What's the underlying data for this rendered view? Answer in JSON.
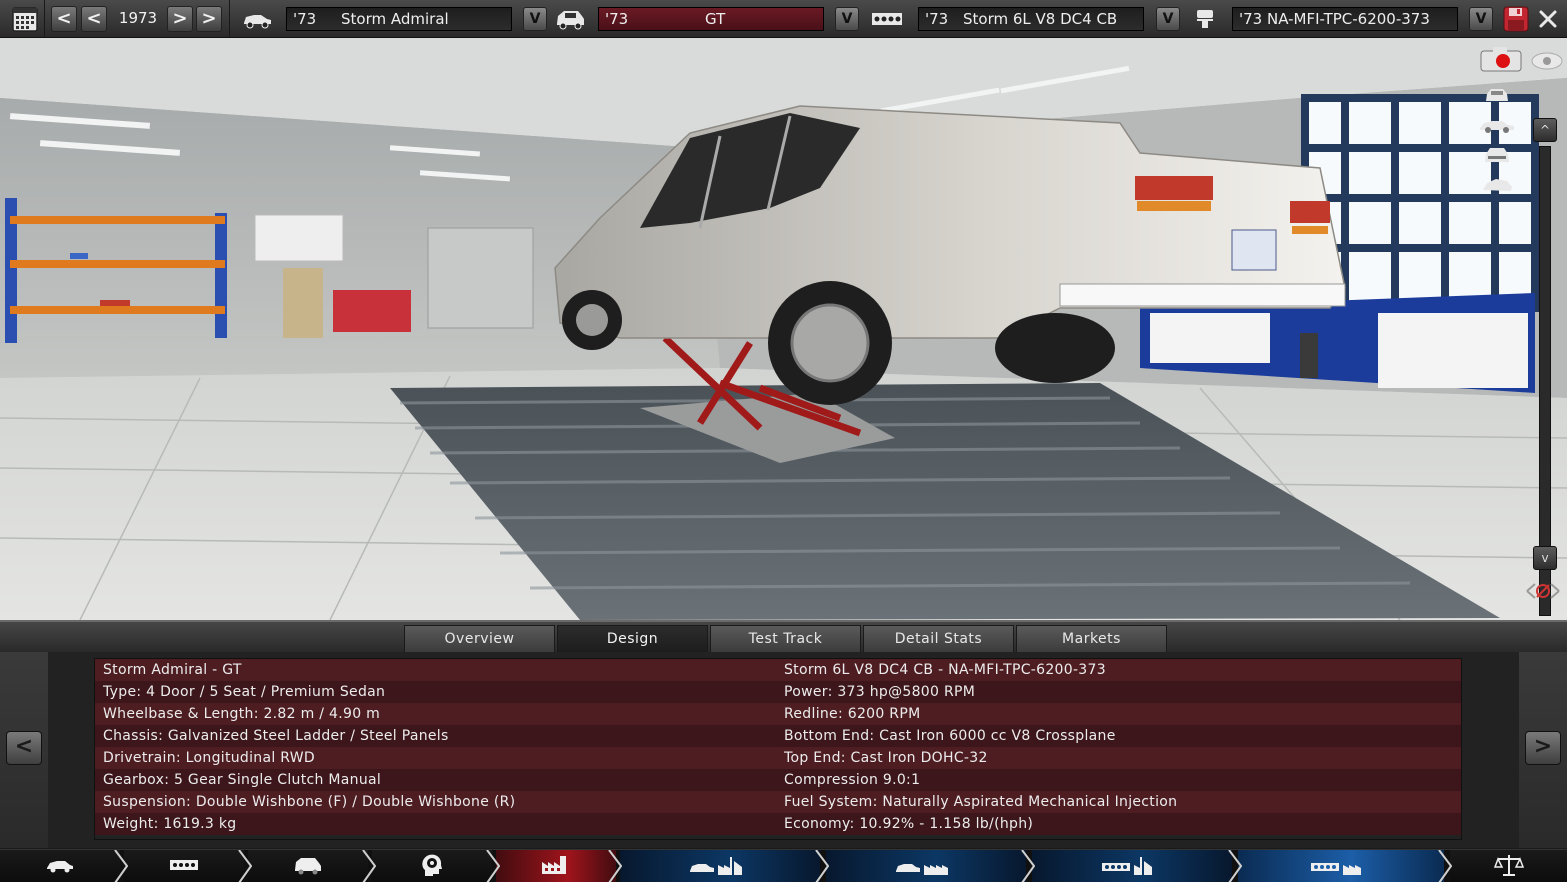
{
  "toolbar": {
    "year": "1973",
    "prev_fast": "<",
    "prev": "<",
    "next": ">",
    "next_fast": ">",
    "model": {
      "year": "'73",
      "name": "Storm Admiral"
    },
    "trim": {
      "year": "'73",
      "name": "GT"
    },
    "engine_family": {
      "year": "'73",
      "name": "Storm 6L V8 DC4 CB"
    },
    "engine_variant": {
      "name": "'73 NA-MFI-TPC-6200-373"
    },
    "dropdown": "V"
  },
  "side_tools": {
    "scroll_up": "^",
    "scroll_down": "v"
  },
  "tabs": [
    {
      "label": "Overview",
      "active": false
    },
    {
      "label": "Design",
      "active": true
    },
    {
      "label": "Test Track",
      "active": false
    },
    {
      "label": "Detail Stats",
      "active": false
    },
    {
      "label": "Markets",
      "active": false
    }
  ],
  "panel": {
    "prev": "<",
    "next": ">",
    "left": [
      "Storm Admiral - GT",
      "Type: 4 Door / 5 Seat / Premium Sedan",
      "Wheelbase & Length: 2.82 m / 4.90 m",
      "Chassis: Galvanized Steel Ladder / Steel Panels",
      "Drivetrain: Longitudinal RWD",
      "Gearbox: 5 Gear Single Clutch Manual",
      "Suspension: Double Wishbone (F) / Double Wishbone (R)",
      "Weight: 1619.3 kg"
    ],
    "right": [
      "Storm 6L V8 DC4 CB - NA-MFI-TPC-6200-373",
      "Power: 373 hp@5800 RPM",
      "Redline: 6200 RPM",
      "Bottom End: Cast Iron 6000 cc V8 Crossplane",
      "Top End: Cast Iron DOHC-32",
      "Compression 9.0:1",
      "Fuel System: Naturally Aspirated Mechanical Injection",
      "Economy: 10.92% - 1.158 lb/(hph)"
    ]
  },
  "bottom_nav": [
    {
      "icon": "car-body-icon",
      "state": "plain"
    },
    {
      "icon": "chassis-icon",
      "state": "plain"
    },
    {
      "icon": "van-icon",
      "state": "plain"
    },
    {
      "icon": "head-gear-icon",
      "state": "plain"
    },
    {
      "icon": "factory-icon",
      "state": "red"
    },
    {
      "icon": "car-factory-icon",
      "state": "blue"
    },
    {
      "icon": "car-production-icon",
      "state": "blue"
    },
    {
      "icon": "engine-factory-icon",
      "state": "blue"
    },
    {
      "icon": "engine-production-icon",
      "state": "blue2"
    },
    {
      "icon": "scales-icon",
      "state": "plain"
    }
  ],
  "colors": {
    "accent_red": "#a0141c",
    "accent_blue": "#0c3764",
    "row_dark": "#3c161a",
    "row_light": "#4e1d22"
  }
}
